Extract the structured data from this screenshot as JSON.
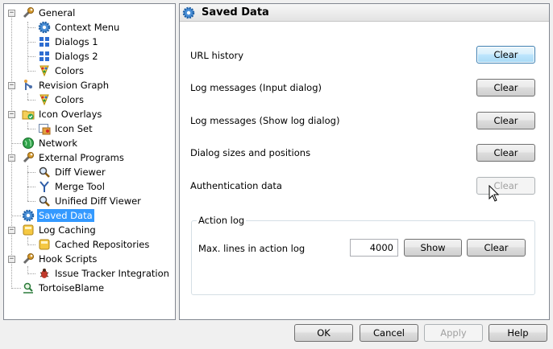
{
  "tree": {
    "items": [
      {
        "label": "General",
        "icon": "wrench-icon"
      },
      {
        "label": "Context Menu",
        "icon": "gear-icon"
      },
      {
        "label": "Dialogs 1",
        "icon": "windows-icon"
      },
      {
        "label": "Dialogs 2",
        "icon": "windows-icon"
      },
      {
        "label": "Colors",
        "icon": "palette-icon"
      },
      {
        "label": "Revision Graph",
        "icon": "graph-icon"
      },
      {
        "label": "Colors",
        "icon": "palette-icon"
      },
      {
        "label": "Icon Overlays",
        "icon": "folder-check-icon"
      },
      {
        "label": "Icon Set",
        "icon": "icon-set-icon"
      },
      {
        "label": "Network",
        "icon": "globe-icon"
      },
      {
        "label": "External Programs",
        "icon": "wrench-icon"
      },
      {
        "label": "Diff Viewer",
        "icon": "magnifier-icon"
      },
      {
        "label": "Merge Tool",
        "icon": "merge-icon"
      },
      {
        "label": "Unified Diff Viewer",
        "icon": "magnifier-icon"
      },
      {
        "label": "Saved Data",
        "icon": "gear-icon"
      },
      {
        "label": "Log Caching",
        "icon": "database-icon"
      },
      {
        "label": "Cached Repositories",
        "icon": "database-icon"
      },
      {
        "label": "Hook Scripts",
        "icon": "wrench-icon"
      },
      {
        "label": "Issue Tracker Integration",
        "icon": "bug-icon"
      },
      {
        "label": "TortoiseBlame",
        "icon": "blame-icon"
      }
    ]
  },
  "panel": {
    "title": "Saved Data",
    "rows": [
      {
        "label": "URL history",
        "button": "Clear"
      },
      {
        "label": "Log messages (Input dialog)",
        "button": "Clear"
      },
      {
        "label": "Log messages (Show log dialog)",
        "button": "Clear"
      },
      {
        "label": "Dialog sizes and positions",
        "button": "Clear"
      },
      {
        "label": "Authentication data",
        "button": "Clear"
      }
    ],
    "action_log": {
      "legend": "Action log",
      "max_lines_label": "Max. lines in action log",
      "max_lines_value": "4000",
      "show_label": "Show",
      "clear_label": "Clear"
    }
  },
  "footer": {
    "ok": "OK",
    "cancel": "Cancel",
    "apply": "Apply",
    "help": "Help"
  }
}
